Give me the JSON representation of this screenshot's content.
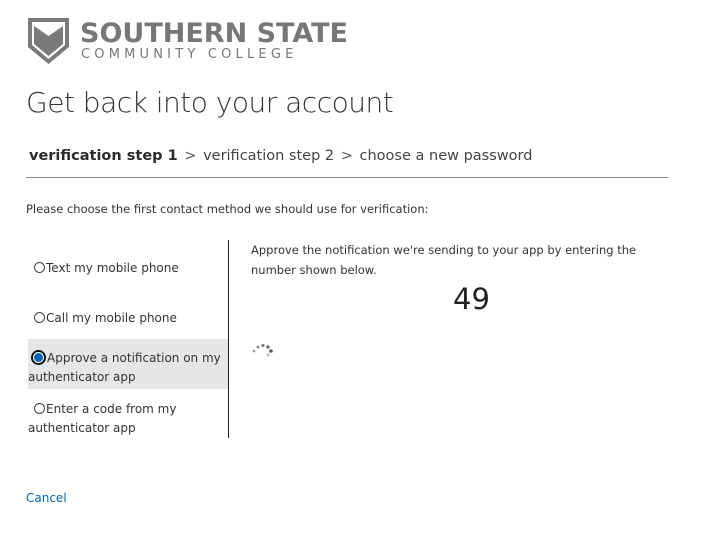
{
  "logo": {
    "line1": "SOUTHERN STATE",
    "line2": "COMMUNITY COLLEGE"
  },
  "page_title": "Get back into your account",
  "breadcrumb": {
    "step1": "verification step 1",
    "separator": ">",
    "step2": "verification step 2",
    "step3": "choose a new password"
  },
  "instructions": "Please choose the first contact method we should use for verification:",
  "options": [
    {
      "label": "Text my mobile phone",
      "selected": false
    },
    {
      "label": "Call my mobile phone",
      "selected": false
    },
    {
      "label": "Approve a notification on my authenticator app",
      "selected": true
    },
    {
      "label": "Enter a code from my authenticator app",
      "selected": false
    }
  ],
  "detail": {
    "message": "Approve the notification we're sending to your app by entering the number shown below.",
    "number": "49"
  },
  "cancel_label": "Cancel",
  "colors": {
    "accent": "#0067b8",
    "logo_gray": "#777777",
    "selected_bg": "#e6e6e6"
  },
  "icons": {
    "logo": "shield-icon",
    "loading": "loading-spinner-icon"
  }
}
